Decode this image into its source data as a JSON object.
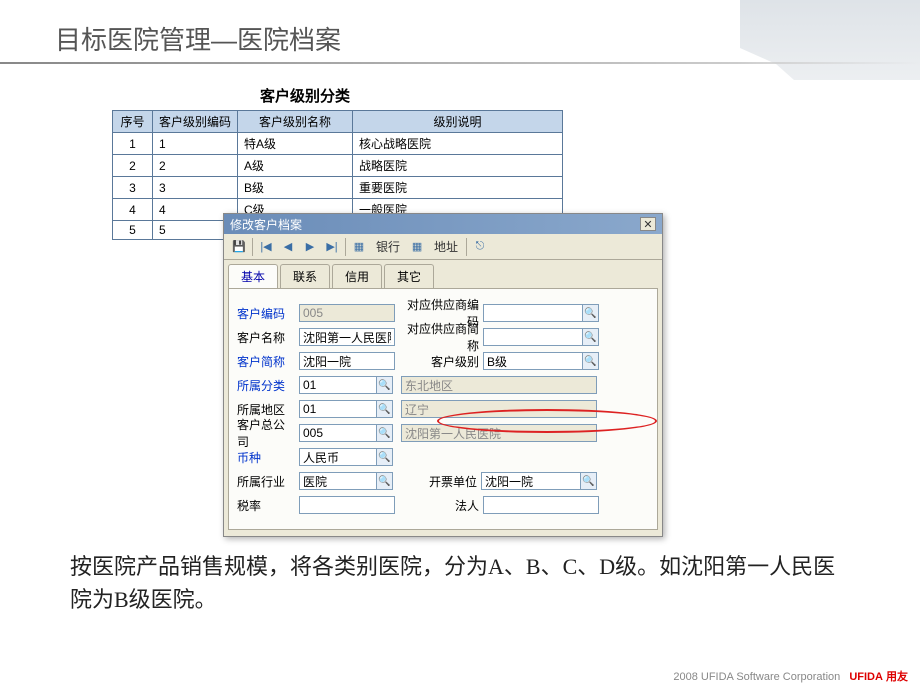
{
  "page": {
    "title": "目标医院管理—医院档案"
  },
  "table": {
    "title": "客户级别分类",
    "headers": {
      "seq": "序号",
      "code": "客户级别编码",
      "name": "客户级别名称",
      "desc": "级别说明"
    },
    "rows": [
      {
        "seq": "1",
        "code": "1",
        "name": "特A级",
        "desc": "核心战略医院"
      },
      {
        "seq": "2",
        "code": "2",
        "name": "A级",
        "desc": "战略医院"
      },
      {
        "seq": "3",
        "code": "3",
        "name": "B级",
        "desc": "重要医院"
      },
      {
        "seq": "4",
        "code": "4",
        "name": "C级",
        "desc": "一般医院"
      },
      {
        "seq": "5",
        "code": "5",
        "name": "",
        "desc": ""
      }
    ]
  },
  "dialog": {
    "title": "修改客户档案",
    "toolbar": {
      "bank": "银行",
      "address": "地址"
    },
    "tabs": {
      "basic": "基本",
      "contact": "联系",
      "credit": "信用",
      "other": "其它"
    },
    "labels": {
      "code": "客户编码",
      "name": "客户名称",
      "short": "客户简称",
      "category": "所属分类",
      "region": "所属地区",
      "hq": "客户总公司",
      "currency": "币种",
      "industry": "所属行业",
      "tax": "税率",
      "supplier_code": "对应供应商编码",
      "supplier_short": "对应供应商简称",
      "level": "客户级别",
      "invoice_unit": "开票单位",
      "legal": "法人"
    },
    "values": {
      "code": "005",
      "name": "沈阳第一人民医院",
      "short": "沈阳一院",
      "category": "01",
      "category_name": "东北地区",
      "region": "01",
      "region_name": "辽宁",
      "hq": "005",
      "hq_name": "沈阳第一人民医院",
      "currency": "人民币",
      "industry": "医院",
      "tax": "",
      "supplier_code": "",
      "supplier_short": "",
      "level": "B级",
      "invoice_unit": "沈阳一院",
      "legal": ""
    }
  },
  "description": "按医院产品销售规模，将各类别医院，分为A、B、C、D级。如沈阳第一人民医院为B级医院。",
  "footer": {
    "corp": "2008 UFIDA Software Corporation",
    "brand": "UFIDA",
    "cn": "用友"
  }
}
